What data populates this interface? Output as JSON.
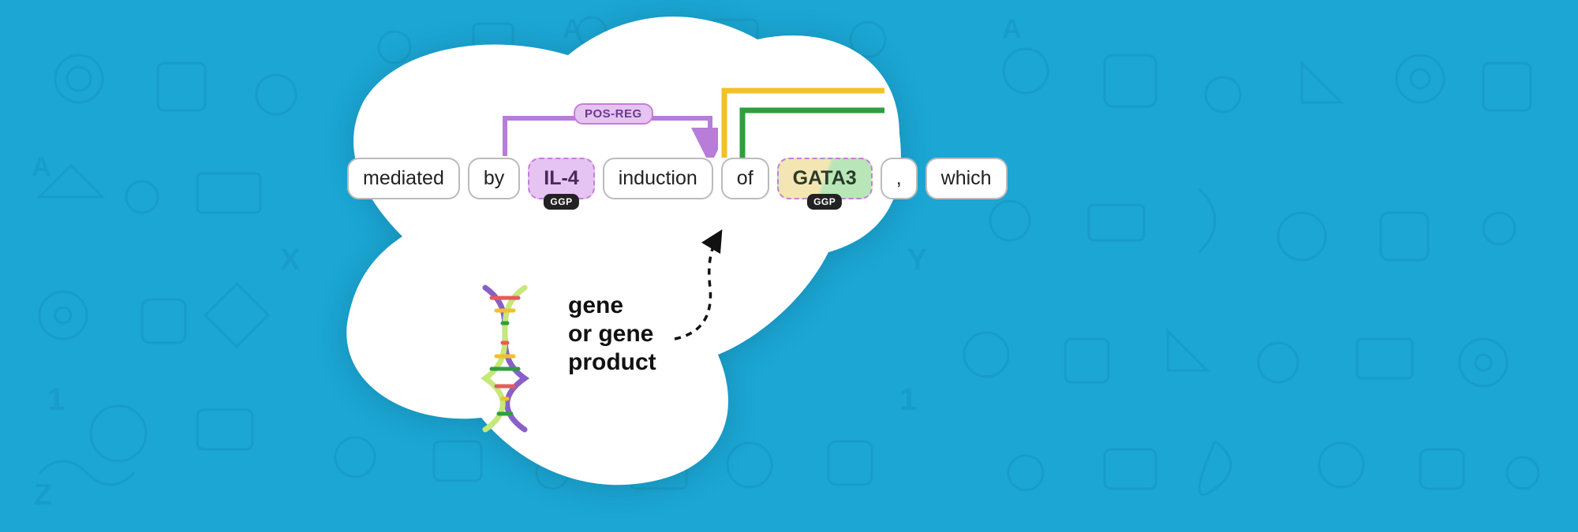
{
  "annotation": {
    "relation_label": "POS-REG",
    "entity_badge": "GGP",
    "tokens": [
      "mediated",
      "by",
      "IL-4",
      "induction",
      "of",
      "GATA3",
      ",",
      "which"
    ]
  },
  "caption": {
    "line1": "gene",
    "line2": "or gene",
    "line3": "product"
  }
}
